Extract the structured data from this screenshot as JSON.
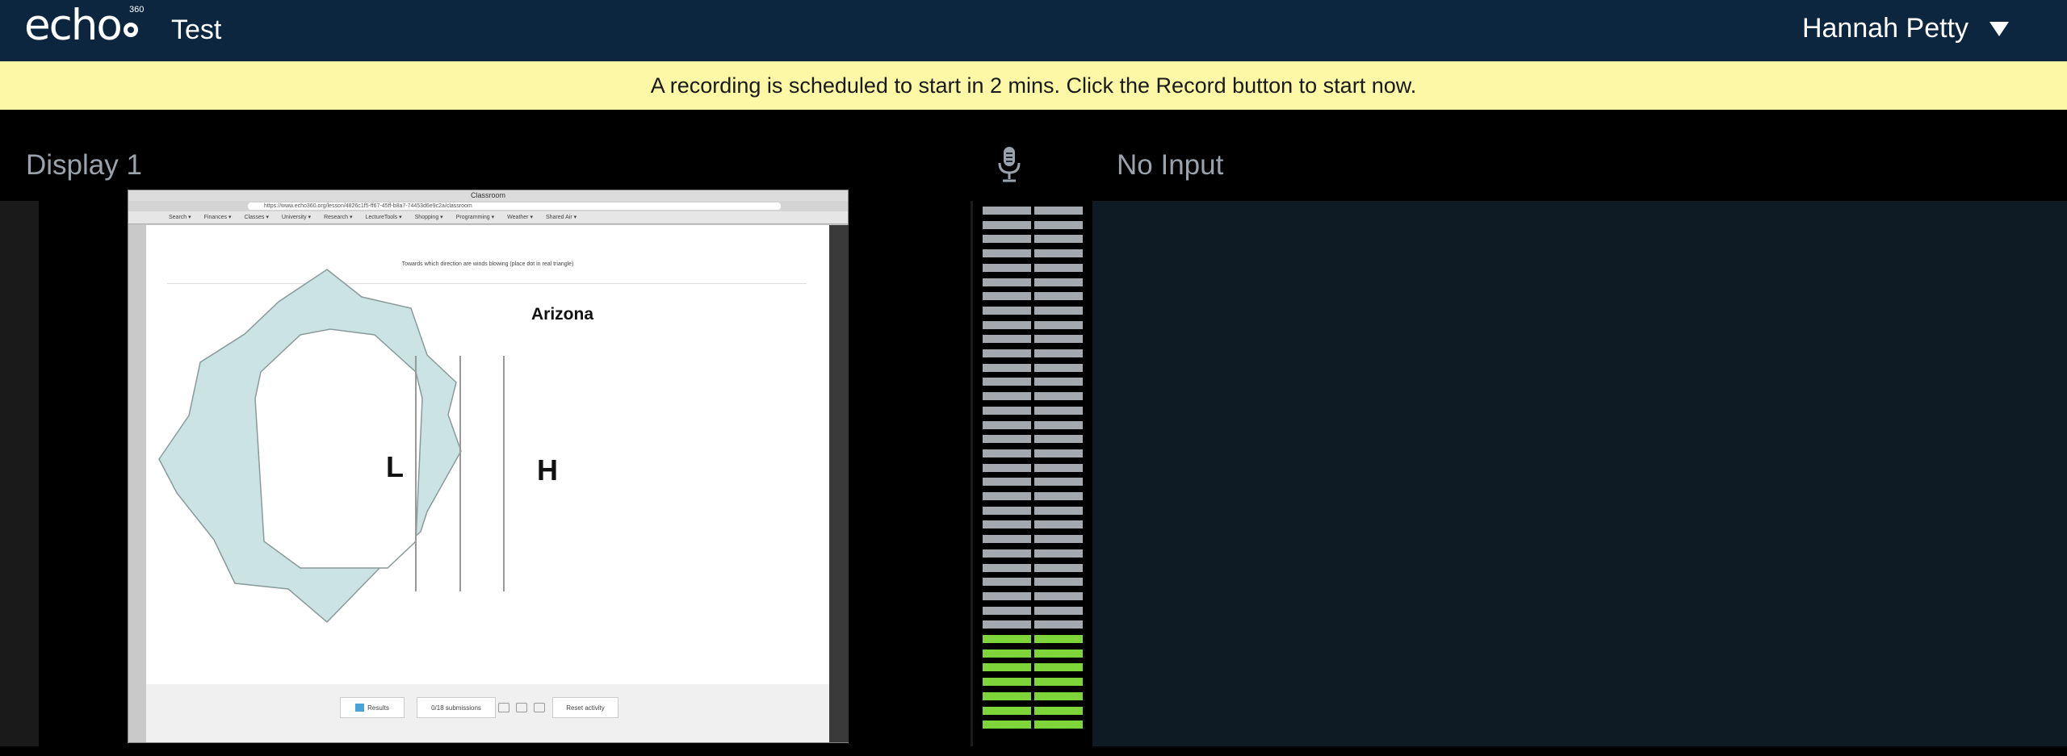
{
  "header": {
    "logo_text": "echo",
    "logo_sup": "360",
    "app_title": "Test",
    "user_name": "Hannah Petty"
  },
  "banner": {
    "message": "A recording is scheduled to start in 2 mins. Click the Record button to start now."
  },
  "display": {
    "label": "Display 1"
  },
  "audio": {
    "label": "No Input",
    "level_fraction": 0.19,
    "segments_total": 37,
    "segments_lit": 7
  },
  "screenshot": {
    "window_title": "Classroom",
    "url": "https://www.echo360.org/lesson/4826c1f5-ff67-45ff-b8a7-74453d6e9c2a/classroom",
    "bookmarks": [
      "Search ▾",
      "Finances ▾",
      "Classes ▾",
      "University ▾",
      "Research ▾",
      "LectureTools ▾",
      "Shopping ▾",
      "Programming ▾",
      "Weather ▾",
      "Shared Air ▾"
    ],
    "question": "Towards which direction are winds blowing (place dot in real triangle)",
    "map_label": "Arizona",
    "low_label": "L",
    "high_label": "H",
    "results_button": "Results",
    "submissions": "0/18 submissions",
    "reset_button": "Reset activity"
  },
  "colors": {
    "topbar": "#0d2640",
    "banner": "#fdf8a5",
    "meter_idle": "#a3a9ae",
    "meter_active": "#7ed53a",
    "video_panel": "#0e1b24"
  }
}
